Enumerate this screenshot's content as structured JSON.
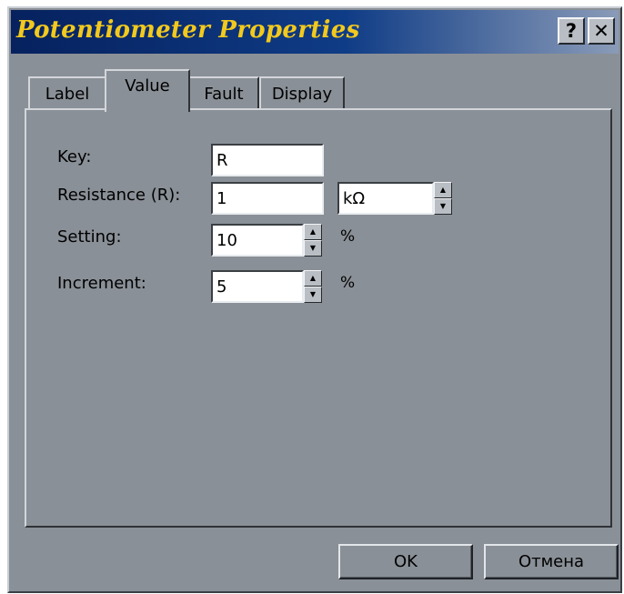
{
  "window": {
    "title": "Potentiometer Properties",
    "help_label": "?",
    "close_label": "✕"
  },
  "tabs": [
    {
      "label": "Label",
      "active": false
    },
    {
      "label": "Value",
      "active": true
    },
    {
      "label": "Fault",
      "active": false
    },
    {
      "label": "Display",
      "active": false
    }
  ],
  "fields": {
    "key": {
      "label": "Key:",
      "value": "R"
    },
    "resistance": {
      "label": "Resistance (R):",
      "value": "1",
      "unit": "kΩ"
    },
    "setting": {
      "label": "Setting:",
      "value": "10",
      "unit": "%"
    },
    "increment": {
      "label": "Increment:",
      "value": "5",
      "unit": "%"
    }
  },
  "buttons": {
    "ok": "OK",
    "cancel": "Отмена"
  },
  "colors": {
    "title_bar": "#06215e",
    "title_text": "#f2c91d",
    "dialog_bg": "#8a9097"
  },
  "icons": {
    "spin_up": "▲",
    "spin_down": "▼"
  }
}
